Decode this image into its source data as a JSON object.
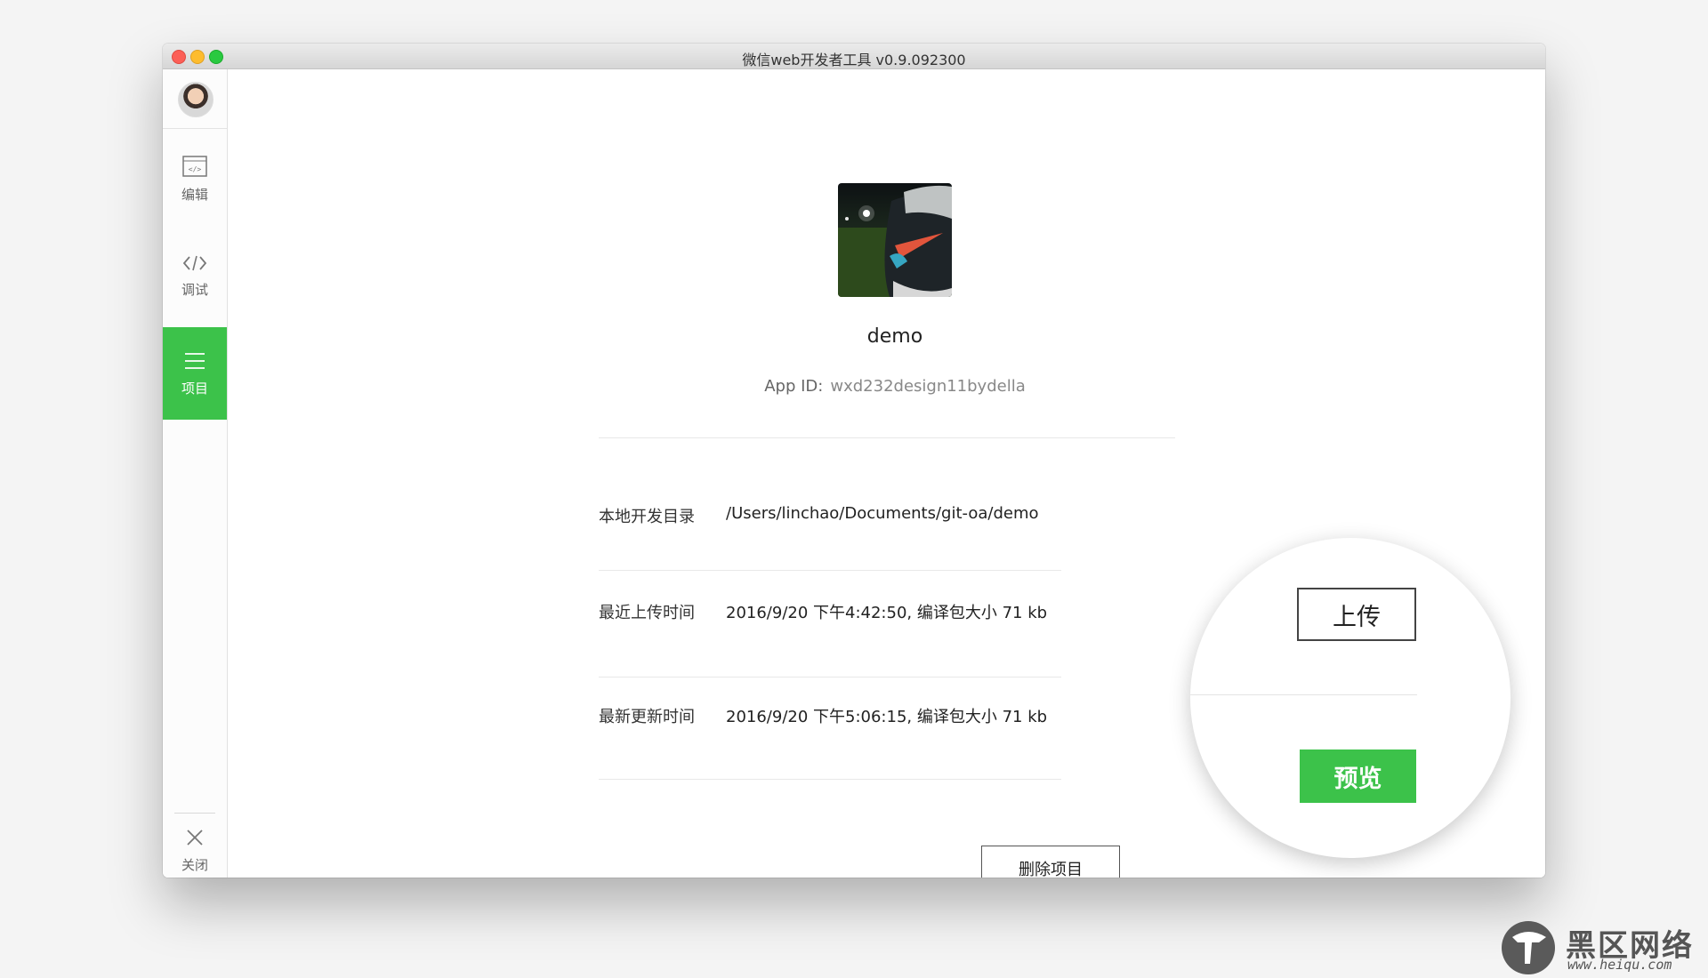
{
  "window": {
    "title": "微信web开发者工具 v0.9.092300"
  },
  "sidebar": {
    "items": [
      {
        "label": "编辑",
        "icon": "edit-icon"
      },
      {
        "label": "调试",
        "icon": "code-icon"
      },
      {
        "label": "项目",
        "icon": "menu-icon",
        "active": true
      }
    ],
    "close_label": "关闭"
  },
  "project": {
    "name": "demo",
    "appid_label": "App ID:",
    "appid_value": "wxd232design11bydella",
    "rows": [
      {
        "label": "本地开发目录",
        "value": "/Users/linchao/Documents/git-oa/demo"
      },
      {
        "label": "最近上传时间",
        "value": "2016/9/20 下午4:42:50, 编译包大小 71 kb"
      },
      {
        "label": "最新更新时间",
        "value": "2016/9/20 下午5:06:15, 编译包大小 71 kb"
      }
    ],
    "delete_label": "删除项目"
  },
  "actions": {
    "upload_label": "上传",
    "preview_label": "预览"
  },
  "watermark": {
    "title": "黑区网络",
    "url": "www.heiqu.com"
  },
  "colors": {
    "accent_green": "#3cc24a",
    "close_red": "#fc5f57",
    "minimize_yellow": "#fdbc2e",
    "maximize_green": "#29c940"
  }
}
